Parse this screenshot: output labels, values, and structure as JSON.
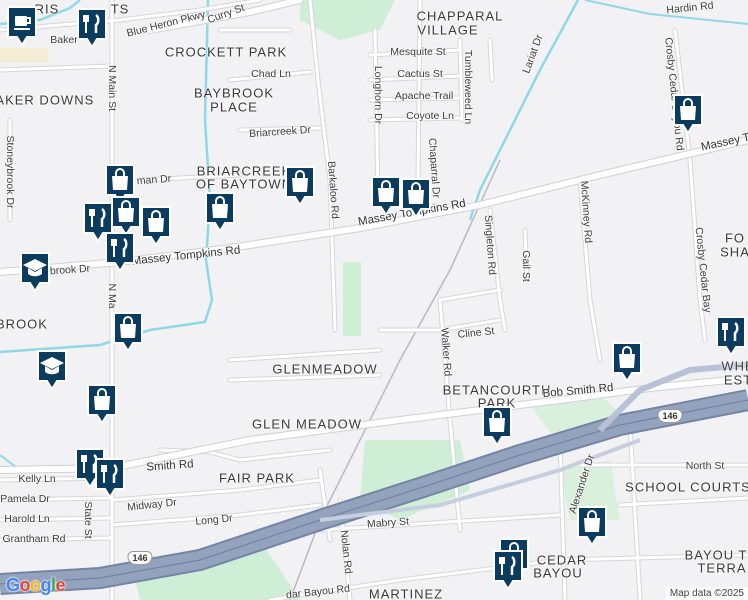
{
  "area_labels": [
    {
      "id": "chapparal-village-1",
      "text": "CHAPPARAL"
    },
    {
      "id": "chapparal-village-2",
      "text": "VILLAGE"
    },
    {
      "id": "crockett-park",
      "text": "CROCKETT PARK"
    },
    {
      "id": "baker-downs",
      "text": "BAKER DOWNS"
    },
    {
      "id": "baybrook-place-1",
      "text": "BAYBROOK"
    },
    {
      "id": "baybrook-place-2",
      "text": "PLACE"
    },
    {
      "id": "briarcreek-1",
      "text": "BRIARCREEK"
    },
    {
      "id": "briarcreek-2",
      "text": "OF BAYTOWN"
    },
    {
      "id": "glenmeadow",
      "text": "GLENMEADOW"
    },
    {
      "id": "glen-meadow",
      "text": "GLEN MEADOW"
    },
    {
      "id": "betancourth-1",
      "text": "BETANCOURTH"
    },
    {
      "id": "betancourth-2",
      "text": "PARK"
    },
    {
      "id": "fair-park",
      "text": "FAIR PARK"
    },
    {
      "id": "school-courts",
      "text": "SCHOOL COURTS"
    },
    {
      "id": "bayou-terrace-1",
      "text": "BAYOU T"
    },
    {
      "id": "bayou-terrace-2",
      "text": "TERRA"
    },
    {
      "id": "cedar-bayou-1",
      "text": "CEDAR"
    },
    {
      "id": "cedar-bayou-2",
      "text": "BAYOU"
    },
    {
      "id": "martinez",
      "text": "MARTINEZ"
    },
    {
      "id": "brook",
      "text": "BROOK"
    },
    {
      "id": "fo-sha-1",
      "text": "FO"
    },
    {
      "id": "fo-sha-2",
      "text": "SHA"
    },
    {
      "id": "whe-est-1",
      "text": "WHE"
    },
    {
      "id": "whe-est-2",
      "text": "EST"
    },
    {
      "id": "tris",
      "text": "RIS"
    },
    {
      "id": "ts",
      "text": "TS"
    }
  ],
  "street_labels": [
    {
      "id": "blue-heron",
      "text": "Blue Heron Pkwy"
    },
    {
      "id": "curry-st",
      "text": "Curry St"
    },
    {
      "id": "hardin-rd",
      "text": "Hardin Rd"
    },
    {
      "id": "mesquite-st",
      "text": "Mesquite St"
    },
    {
      "id": "cactus-st",
      "text": "Cactus St"
    },
    {
      "id": "apache-trail",
      "text": "Apache Trail"
    },
    {
      "id": "coyote-ln",
      "text": "Coyote Ln"
    },
    {
      "id": "chad-ln",
      "text": "Chad Ln"
    },
    {
      "id": "briarcreek-dr",
      "text": "Briarcreek Dr"
    },
    {
      "id": "longhorn-dr",
      "text": "Longhorn Dr"
    },
    {
      "id": "tumbleweed-ln",
      "text": "Tumbleweed Ln"
    },
    {
      "id": "lariat-dr",
      "text": "Lariat Dr"
    },
    {
      "id": "n-main-st",
      "text": "N Main St"
    },
    {
      "id": "n-main-st-2",
      "text": "N Ma"
    },
    {
      "id": "stoneybrook-dr",
      "text": "Stoneybrook Dr"
    },
    {
      "id": "barkaloo-rd",
      "text": "Barkaloo Rd"
    },
    {
      "id": "chaparral-dr",
      "text": "Chaparral Dr"
    },
    {
      "id": "singleton-rd",
      "text": "Singleton Rd"
    },
    {
      "id": "gail-st",
      "text": "Gail St"
    },
    {
      "id": "mckinney-rd",
      "text": "McKinney Rd"
    },
    {
      "id": "crosby-cedar-bayou",
      "text": "Crosby Cedar Bayou Rd"
    },
    {
      "id": "crosby-cedar-bay",
      "text": "Crosby Cedar Bay"
    },
    {
      "id": "cline-st",
      "text": "Cline St"
    },
    {
      "id": "walker-rd",
      "text": "Walker Rd"
    },
    {
      "id": "north-st",
      "text": "North St"
    },
    {
      "id": "kelly-ln",
      "text": "Kelly Ln"
    },
    {
      "id": "pamela-dr",
      "text": "Pamela Dr"
    },
    {
      "id": "harold-ln",
      "text": "Harold Ln"
    },
    {
      "id": "grantham-rd",
      "text": "Grantham Rd"
    },
    {
      "id": "state-st",
      "text": "State St"
    },
    {
      "id": "midway-dr",
      "text": "Midway Dr"
    },
    {
      "id": "long-dr",
      "text": "Long Dr"
    },
    {
      "id": "mabry-st",
      "text": "Mabry St"
    },
    {
      "id": "nolan-rd",
      "text": "Nolan Rd"
    },
    {
      "id": "alexander-dr",
      "text": "Alexander Dr"
    },
    {
      "id": "cedar-bayou-rd",
      "text": "dar Bayou Rd"
    },
    {
      "id": "baker",
      "text": "Baker"
    },
    {
      "id": "man-dr",
      "text": "man Dr"
    },
    {
      "id": "brook-dr",
      "text": "brook Dr"
    }
  ],
  "major_road_labels": [
    {
      "id": "massey-tompkins-1",
      "text": "Massey Tompkins Rd"
    },
    {
      "id": "massey-tompkins-2",
      "text": "Massey Tompkins Rd"
    },
    {
      "id": "massey-tompkins-3",
      "text": "Massey To"
    },
    {
      "id": "bob-smith-1",
      "text": "Bob Smith Rd"
    },
    {
      "id": "bob-smith-2",
      "text": "Smith Rd"
    }
  ],
  "highway_shields": [
    {
      "id": "shield-146-left",
      "text": "146"
    },
    {
      "id": "shield-146-right",
      "text": "146"
    }
  ],
  "markers": [
    {
      "id": "cafe-topleft",
      "type": "cafe"
    },
    {
      "id": "restaurant-top",
      "type": "restaurant"
    },
    {
      "id": "shop-barkaloo",
      "type": "shopping"
    },
    {
      "id": "shop-briarcreek",
      "type": "shopping"
    },
    {
      "id": "shop-massey-1",
      "type": "shopping"
    },
    {
      "id": "shop-massey-2",
      "type": "shopping"
    },
    {
      "id": "shop-topright",
      "type": "shopping"
    },
    {
      "id": "shop-main-1",
      "type": "shopping"
    },
    {
      "id": "shop-main-2",
      "type": "shopping"
    },
    {
      "id": "shop-main-3",
      "type": "shopping"
    },
    {
      "id": "restaurant-main-1",
      "type": "restaurant"
    },
    {
      "id": "restaurant-main-2",
      "type": "restaurant"
    },
    {
      "id": "school-1",
      "type": "school"
    },
    {
      "id": "shop-brook",
      "type": "shopping"
    },
    {
      "id": "school-2",
      "type": "school"
    },
    {
      "id": "shop-glen",
      "type": "shopping"
    },
    {
      "id": "restaurant-bob-1",
      "type": "restaurant"
    },
    {
      "id": "restaurant-bob-2",
      "type": "restaurant"
    },
    {
      "id": "shop-betancourth",
      "type": "shopping"
    },
    {
      "id": "shop-walker",
      "type": "shopping"
    },
    {
      "id": "restaurant-right",
      "type": "restaurant"
    },
    {
      "id": "shop-alexander",
      "type": "shopping"
    },
    {
      "id": "shop-cedar",
      "type": "shopping"
    },
    {
      "id": "restaurant-cedar",
      "type": "restaurant"
    }
  ],
  "logo": "Google",
  "attribution": "Map data ©2025",
  "colors": {
    "background": "#f2f1f4",
    "park": "#cfeed6",
    "water": "#8fd8e8",
    "road": "#ffffff",
    "road_outline": "#d6d5da",
    "highway": "#8a99b5",
    "marker": "#0b3b5e",
    "marker_border": "#ffffff"
  }
}
